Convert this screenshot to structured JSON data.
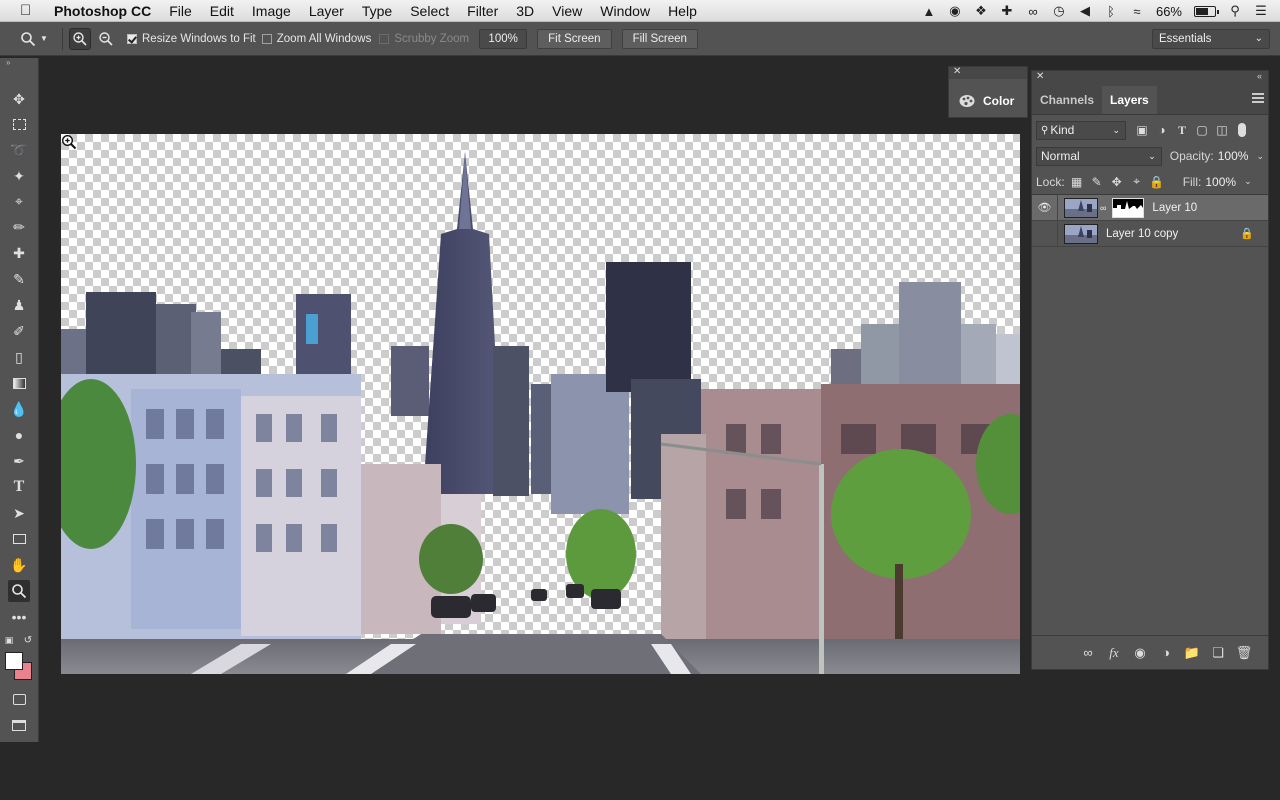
{
  "menubar": {
    "app": "Photoshop CC",
    "items": [
      "File",
      "Edit",
      "Image",
      "Layer",
      "Type",
      "Select",
      "Filter",
      "3D",
      "View",
      "Window",
      "Help"
    ],
    "battery": "66%"
  },
  "options": {
    "resize_windows": "Resize Windows to Fit",
    "zoom_all": "Zoom All Windows",
    "scrubby": "Scrubby Zoom",
    "zoom_value": "100%",
    "fit_screen": "Fit Screen",
    "fill_screen": "Fill Screen",
    "workspace": "Essentials"
  },
  "color_panel": {
    "label": "Color"
  },
  "layers_panel": {
    "tabs": [
      "Channels",
      "Layers"
    ],
    "filter_kind": "Kind",
    "blend_mode": "Normal",
    "opacity_label": "Opacity:",
    "opacity_value": "100%",
    "lock_label": "Lock:",
    "fill_label": "Fill:",
    "fill_value": "100%",
    "layers": [
      {
        "name": "Layer 10"
      },
      {
        "name": "Layer 10 copy"
      }
    ]
  }
}
